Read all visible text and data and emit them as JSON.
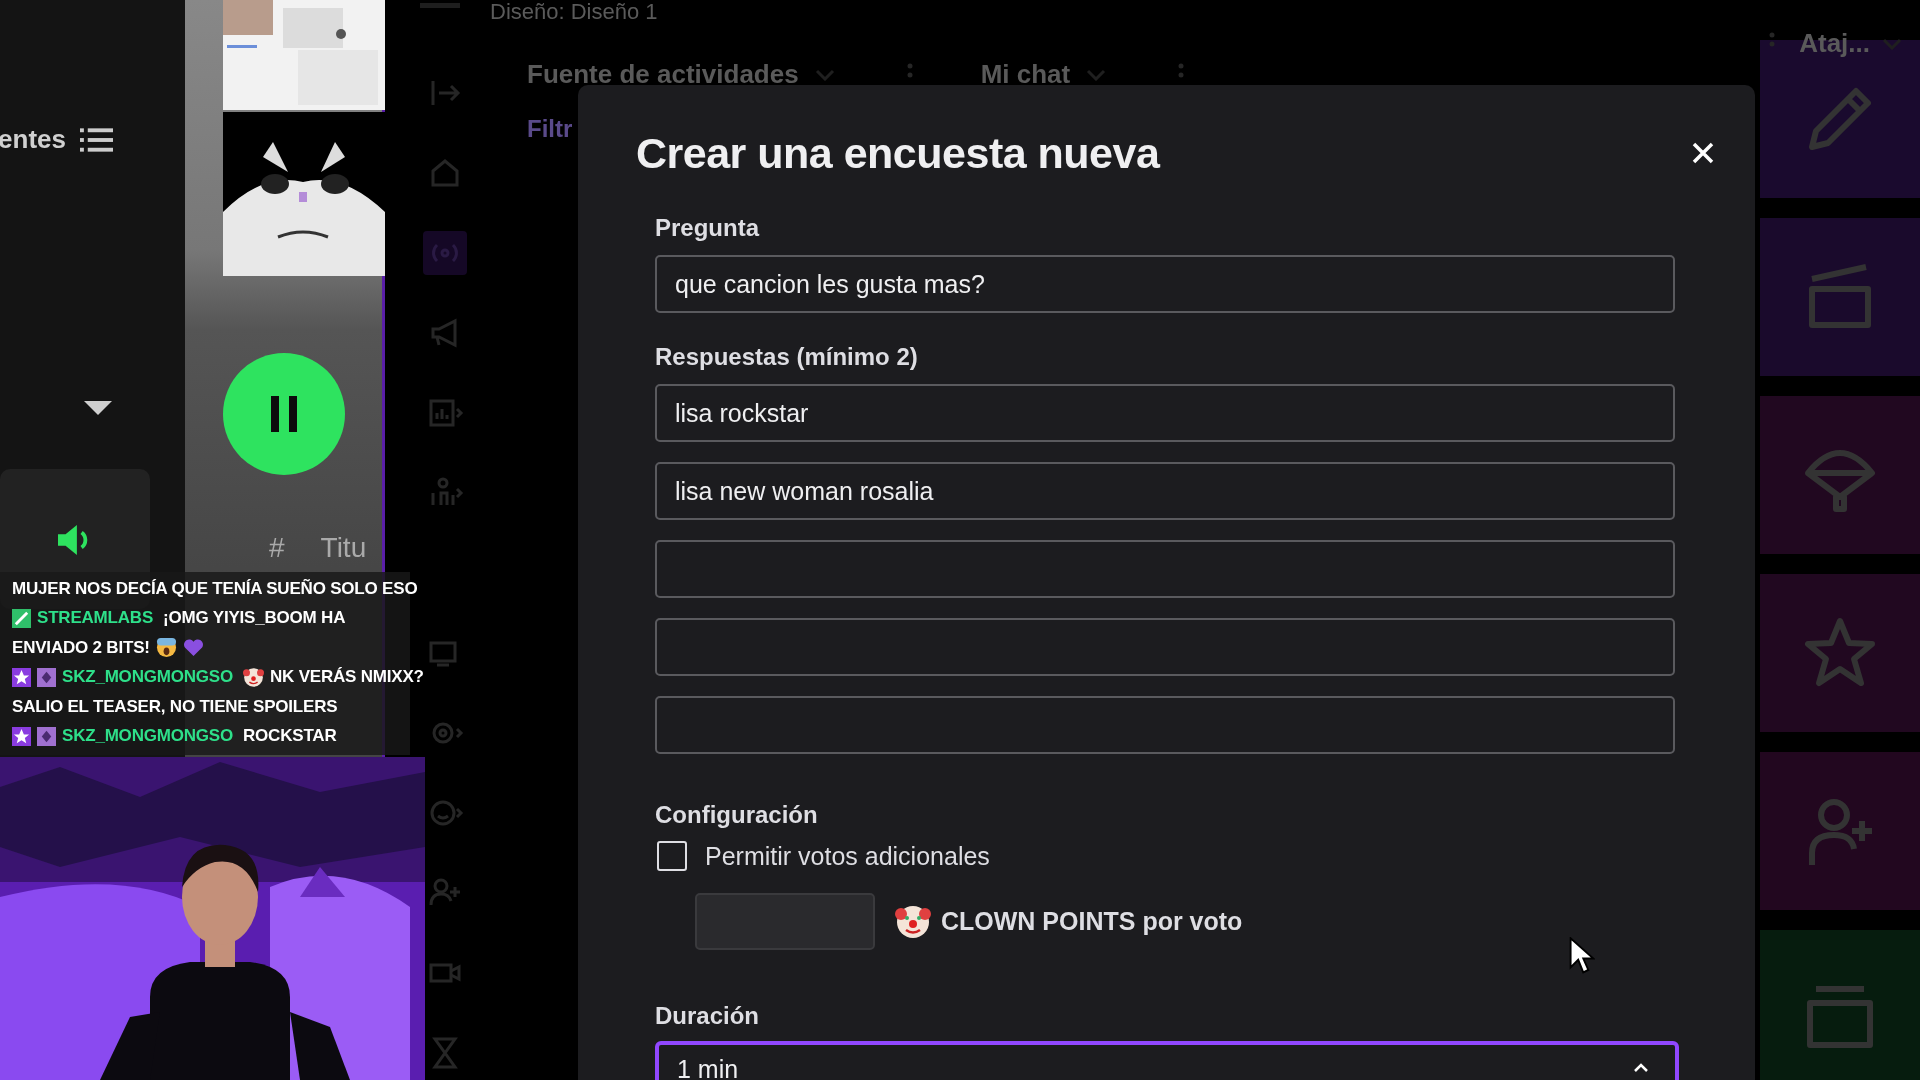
{
  "sources_panel": {
    "title": "entes"
  },
  "media_column": {
    "playing": true,
    "columns": [
      "#",
      "Titu"
    ]
  },
  "dashboard": {
    "layout_label": "Diseño: Diseño 1",
    "rail": [
      {
        "kind": "collapse",
        "selected": false
      },
      {
        "kind": "home",
        "selected": false
      },
      {
        "kind": "broadcast",
        "selected": true
      },
      {
        "kind": "megaphone",
        "selected": false
      },
      {
        "kind": "chart",
        "selected": false
      },
      {
        "kind": "community",
        "selected": false
      },
      {
        "kind": "screen",
        "selected": false
      },
      {
        "kind": "gear",
        "selected": false
      },
      {
        "kind": "smiley",
        "selected": false
      },
      {
        "kind": "person-add",
        "selected": false
      },
      {
        "kind": "camera",
        "selected": false
      },
      {
        "kind": "hourglass",
        "selected": false
      }
    ],
    "panels": [
      {
        "title": "Fuente de actividades"
      },
      {
        "title": "Mi chat"
      }
    ],
    "filter_label": "Filtr",
    "shortcuts_title": "Ataj...",
    "quick_actions": [
      {
        "kind": "pencil",
        "color": "#1a0a2e"
      },
      {
        "kind": "clapper",
        "color": "#1a0a2c"
      },
      {
        "kind": "parachute",
        "color": "#210820"
      },
      {
        "kind": "star",
        "color": "#210820"
      },
      {
        "kind": "person-add",
        "color": "#22071f"
      },
      {
        "kind": "media",
        "color": "#061c0e"
      }
    ]
  },
  "poll_modal": {
    "title": "Crear una encuesta nueva",
    "question_label": "Pregunta",
    "question": "que cancion les gusta mas?",
    "answers_label": "Respuestas (mínimo 2)",
    "answers": [
      {
        "kind": "filled",
        "value": "lisa rockstar"
      },
      {
        "kind": "filled",
        "value": "lisa new woman rosalia"
      },
      {
        "kind": "blank"
      },
      {
        "kind": "blank"
      },
      {
        "kind": "blank"
      }
    ],
    "settings_label": "Configuración",
    "extra_votes": {
      "label": "Permitir votos adicionales",
      "checked": false
    },
    "points_label": "CLOWN POINTS por voto",
    "duration_label": "Duración",
    "duration": "1 min"
  },
  "chat": [
    {
      "segments": [
        {
          "kind": "text",
          "text": "MUJER NOS DECÍA QUE TENÍA SUEÑO SOLO ESO"
        }
      ]
    },
    {
      "segments": [
        {
          "kind": "badge-bot"
        },
        {
          "kind": "user",
          "text": "STREAMLABS"
        },
        {
          "kind": "text",
          "text": "¡OMG YIYIS_BOOM HA"
        }
      ]
    },
    {
      "segments": [
        {
          "kind": "text",
          "text": "ENVIADO 2 BITS!"
        },
        {
          "kind": "emoji-scream"
        },
        {
          "kind": "emoji-heart"
        }
      ]
    },
    {
      "segments": [
        {
          "kind": "badge-star"
        },
        {
          "kind": "badge-sub"
        },
        {
          "kind": "user",
          "text": "SKZ_MONGMONGSO"
        },
        {
          "kind": "emoji-clown"
        },
        {
          "kind": "text",
          "text": "NK VERÁS NMIXX?"
        }
      ]
    },
    {
      "segments": [
        {
          "kind": "text",
          "text": "SALIO EL TEASER, NO TIENE SPOILERS"
        }
      ]
    },
    {
      "segments": [
        {
          "kind": "badge-star"
        },
        {
          "kind": "badge-sub"
        },
        {
          "kind": "user",
          "text": "SKZ_MONGMONGSO"
        },
        {
          "kind": "text",
          "text": "ROCKSTAR"
        }
      ]
    }
  ]
}
